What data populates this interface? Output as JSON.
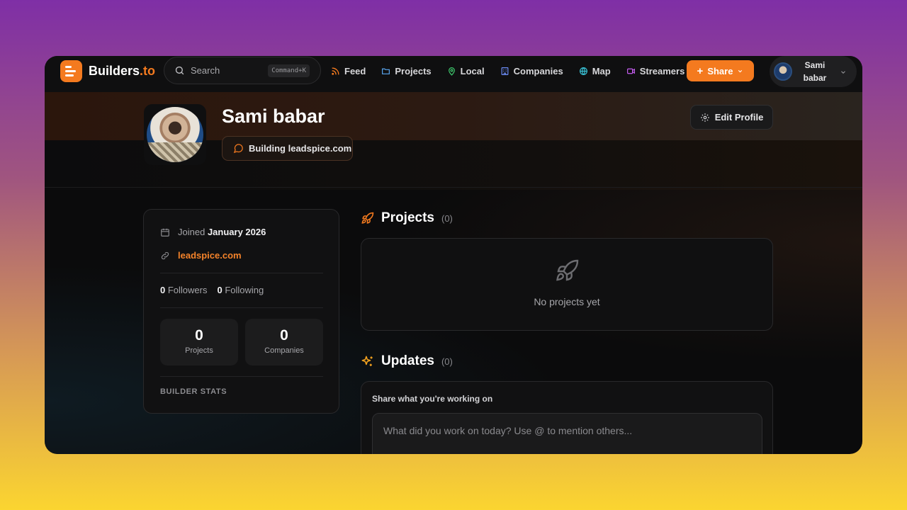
{
  "brand": {
    "name_prefix": "Builders",
    "name_suffix": ".to"
  },
  "search": {
    "placeholder": "Search",
    "shortcut": "Command+K"
  },
  "nav": {
    "items": [
      {
        "label": "Feed",
        "icon": "rss-icon"
      },
      {
        "label": "Projects",
        "icon": "folder-icon"
      },
      {
        "label": "Local",
        "icon": "map-pin-icon"
      },
      {
        "label": "Companies",
        "icon": "building-icon"
      },
      {
        "label": "Map",
        "icon": "globe-icon"
      },
      {
        "label": "Streamers",
        "icon": "video-icon"
      }
    ],
    "share_label": "Share"
  },
  "user_menu": {
    "name_line1": "Sami",
    "name_line2": "babar"
  },
  "profile": {
    "name": "Sami babar",
    "status": "Building leadspice.com",
    "edit_label": "Edit Profile"
  },
  "sidebar": {
    "joined_label": "Joined",
    "joined_date": "January 2026",
    "website": "leadspice.com",
    "followers_count": "0",
    "followers_label": "Followers",
    "following_count": "0",
    "following_label": "Following",
    "stats": [
      {
        "value": "0",
        "label": "Projects"
      },
      {
        "value": "0",
        "label": "Companies"
      }
    ],
    "builder_stats_label": "BUILDER STATS"
  },
  "projects": {
    "title": "Projects",
    "count": "(0)",
    "empty_message": "No projects yet"
  },
  "updates": {
    "title": "Updates",
    "count": "(0)",
    "share_label": "Share what you're working on",
    "input_placeholder": "What did you work on today? Use @ to mention others..."
  },
  "colors": {
    "accent": "#f47a1f",
    "background": "#0b0b0c",
    "card": "#111112"
  }
}
